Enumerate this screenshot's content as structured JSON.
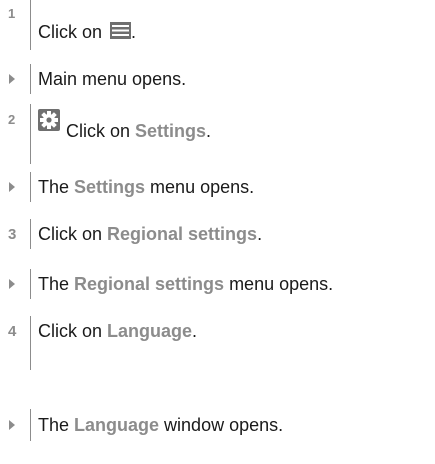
{
  "steps": [
    {
      "marker": "1",
      "before": "Click on ",
      "after": "."
    },
    {
      "result": "Main menu opens."
    },
    {
      "marker": "2",
      "text": "Click on ",
      "link": "Settings",
      "after": "."
    },
    {
      "result_pre": "The ",
      "link": "Settings",
      "result_post": " menu opens."
    },
    {
      "marker": "3",
      "text": "Click on ",
      "link": "Regional settings",
      "after": "."
    },
    {
      "result_pre": "The ",
      "link": "Regional settings",
      "result_post": " menu opens."
    },
    {
      "marker": "4",
      "text": "Click on ",
      "link": "Language",
      "after": "."
    },
    {
      "result_pre": "The ",
      "link": "Language",
      "result_post": " window opens."
    }
  ],
  "icons": {
    "menu": "hamburger-menu-icon",
    "settings": "gear-icon"
  },
  "colors": {
    "highlight": "#8c8c8c",
    "icon_fill": "#6f6f6f",
    "text": "#1a1a1a"
  }
}
